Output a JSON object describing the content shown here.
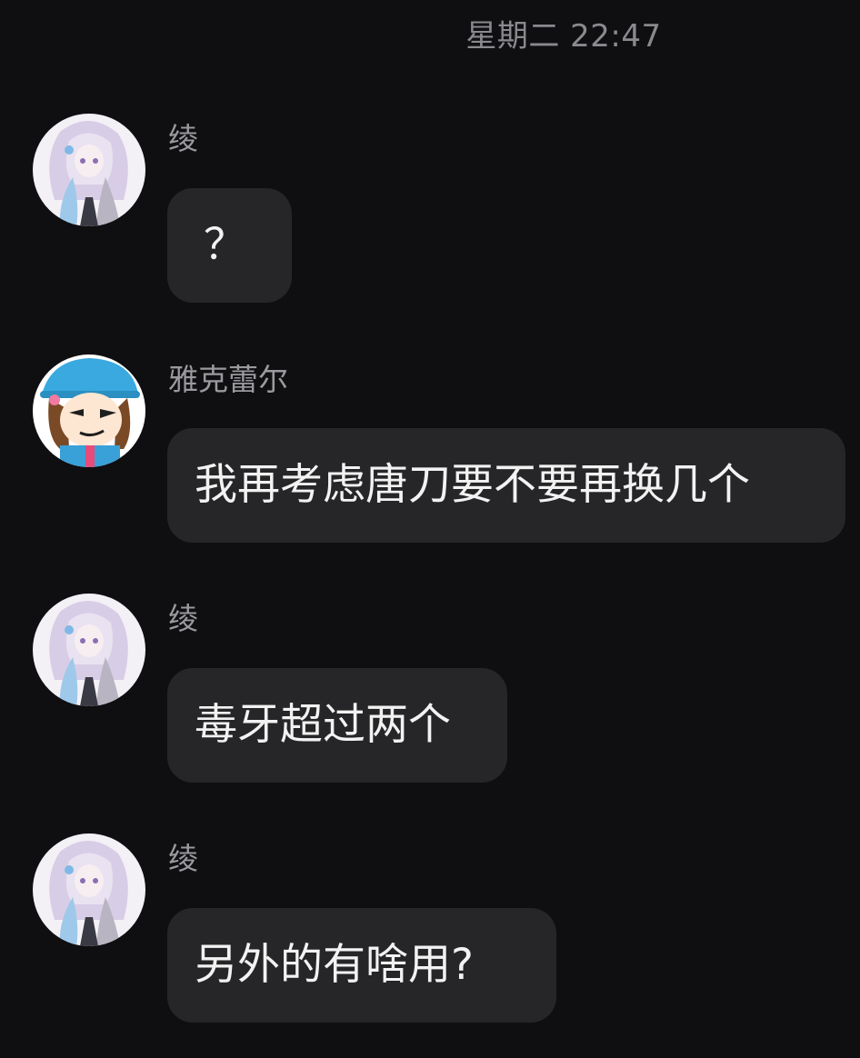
{
  "header": {
    "timestamp": "星期二 22:47"
  },
  "messages": [
    {
      "sender": "绫",
      "text": "？",
      "avatar": "anime-girl-avatar"
    },
    {
      "sender": "雅克蕾尔",
      "text": "我再考虑唐刀要不要再换几个",
      "avatar": "cartoon-character-avatar"
    },
    {
      "sender": "绫",
      "text": "毒牙超过两个",
      "avatar": "anime-girl-avatar"
    },
    {
      "sender": "绫",
      "text": "另外的有啥用?",
      "avatar": "anime-girl-avatar"
    }
  ],
  "colors": {
    "background": "#0f0f12",
    "bubble": "#262628",
    "sender_text": "#9a9a9e",
    "message_text": "#f2f2f2",
    "timestamp_text": "#8a8a8e"
  }
}
